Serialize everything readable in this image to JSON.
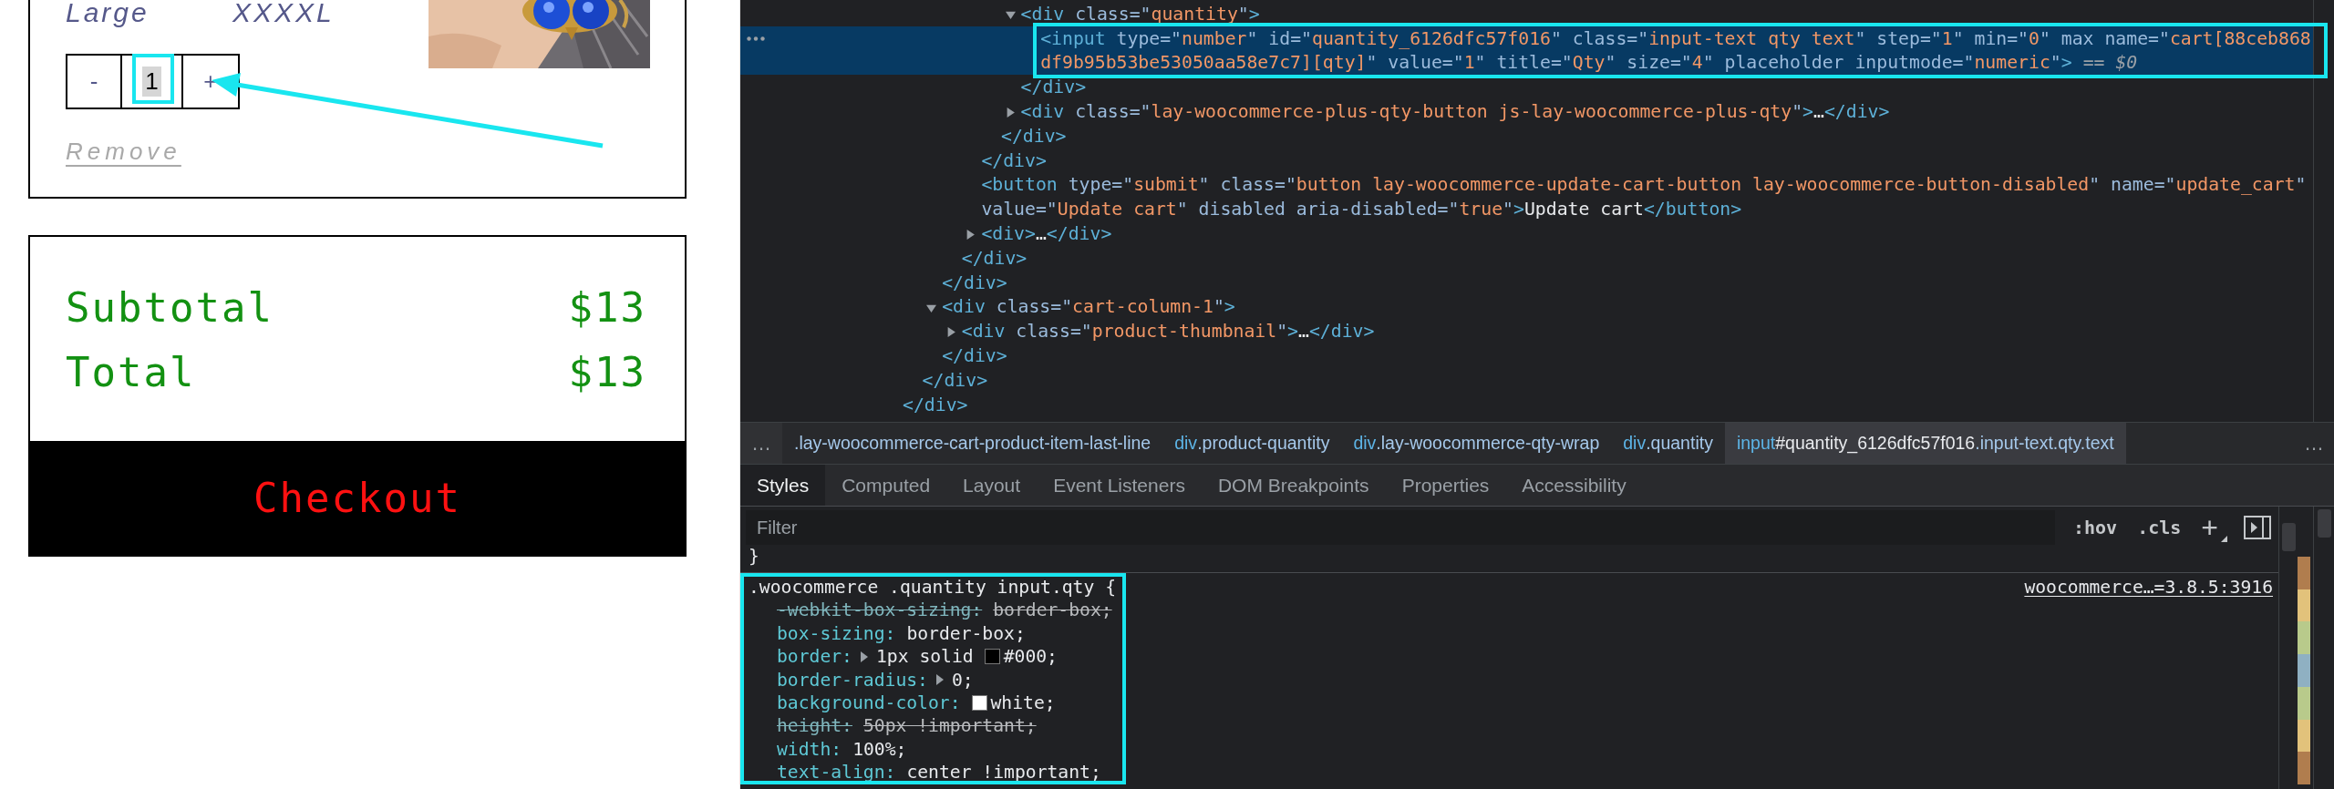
{
  "page": {
    "variant": {
      "name": "Large",
      "value": "XXXXL"
    },
    "quantity": {
      "decrease": "-",
      "value": "1",
      "increase": "+",
      "annotated": true
    },
    "remove_link": "Remove",
    "totals": [
      {
        "label": "Subtotal",
        "amount": "$13"
      },
      {
        "label": "Total",
        "amount": "$13"
      }
    ],
    "checkout_button": "Checkout"
  },
  "devtools": {
    "dom_tree": [
      {
        "close": "</div>",
        "selected": false,
        "children": [
          {
            "close": "</div>",
            "selected": false,
            "children": [
              {
                "close": "</div>",
                "selected": false,
                "children": [
                  {
                    "close": "</div>",
                    "selected": false,
                    "children": [
                      {
                        "close": "</div>",
                        "selected": false,
                        "children": [
                          {
                            "close": "</div>",
                            "selected": false,
                            "children": [
                              {
                                "open": [
                                  "<div class=\"quantity\">"
                                ],
                                "expanded": true,
                                "selected": false,
                                "close": "</div>",
                                "children": [
                                  {
                                    "open": [
                                      "<input type=\"number\" id=\"quantity_6126dfc57f016\" class=\"input-text qty text\" step=\"1\" min=\"0\" max name=\"cart[88ceb868",
                                      "df9b95b53be53050aa58e7c7][qty]\" value=\"1\" title=\"Qty\" size=\"4\" placeholder inputmode=\"numeric\">"
                                    ],
                                    "suffix": "== $0",
                                    "selected": true,
                                    "annotated": true
                                  }
                                ]
                              },
                              {
                                "open": [
                                  "<div class=\"lay-woocommerce-plus-qty-button js-lay-woocommerce-plus-qty\">…</div>"
                                ],
                                "expanded": false,
                                "selected": false
                              }
                            ]
                          }
                        ]
                      },
                      {
                        "open": [
                          "<button type=\"submit\" class=\"button lay-woocommerce-update-cart-button lay-woocommerce-button-disabled\" name=\"update_cart\"",
                          "value=\"Update cart\" disabled aria-disabled=\"true\">Update cart</button>"
                        ],
                        "selected": false
                      },
                      {
                        "open": [
                          "<div>…</div>"
                        ],
                        "expanded": false,
                        "selected": false
                      }
                    ]
                  }
                ]
              },
              {
                "open": [
                  "<div class=\"cart-column-1\">"
                ],
                "expanded": true,
                "selected": false,
                "close": "</div>",
                "children": [
                  {
                    "open": [
                      "<div class=\"product-thumbnail\">…</div>"
                    ],
                    "expanded": false,
                    "selected": false
                  }
                ]
              }
            ]
          }
        ]
      }
    ],
    "breadcrumbs": {
      "more_left": "…",
      "items": [
        {
          "classes": ".lay-woocommerce-cart-product-item-last-line",
          "selected": false
        },
        {
          "tag": "div",
          "classes": ".product-quantity",
          "selected": false
        },
        {
          "tag": "div",
          "classes": ".lay-woocommerce-qty-wrap",
          "selected": false
        },
        {
          "tag": "div",
          "classes": ".quantity",
          "selected": false
        },
        {
          "tag": "input",
          "id": "#quantity_6126dfc57f016",
          "classes": ".input-text.qty.text",
          "selected": true
        }
      ],
      "more_right": "…"
    },
    "tabs": [
      {
        "label": "Styles",
        "selected": true
      },
      {
        "label": "Computed",
        "selected": false
      },
      {
        "label": "Layout",
        "selected": false
      },
      {
        "label": "Event Listeners",
        "selected": false
      },
      {
        "label": "DOM Breakpoints",
        "selected": false
      },
      {
        "label": "Properties",
        "selected": false
      },
      {
        "label": "Accessibility",
        "selected": false
      }
    ],
    "filter": {
      "placeholder": "Filter"
    },
    "filter_tools": [
      ":hov",
      ".cls",
      "+"
    ],
    "styles": {
      "previous_rule_end": "}",
      "rules": [
        {
          "selector": ".woocommerce .quantity input.qty {",
          "source": "woocommerce…=3.8.5:3916",
          "annotated": true,
          "declarations": [
            {
              "name": "-webkit-box-sizing:",
              "value": "border-box;",
              "overridden": true
            },
            {
              "name": "box-sizing:",
              "value": "border-box;",
              "overridden": false
            },
            {
              "name": "border:",
              "expandable": true,
              "value": "1px solid",
              "color": "#000000",
              "color_value": "#000;",
              "overridden": false
            },
            {
              "name": "border-radius:",
              "expandable": true,
              "value": "0;",
              "overridden": false
            },
            {
              "name": "background-color:",
              "color": "#ffffff",
              "color_value": "white;",
              "overridden": false
            },
            {
              "name": "height:",
              "value": "50px !important;",
              "overridden": true
            },
            {
              "name": "width:",
              "value": "100%;",
              "overridden": false
            },
            {
              "name": "text-align:",
              "value": "center !important;",
              "overridden": false
            }
          ]
        }
      ]
    }
  }
}
